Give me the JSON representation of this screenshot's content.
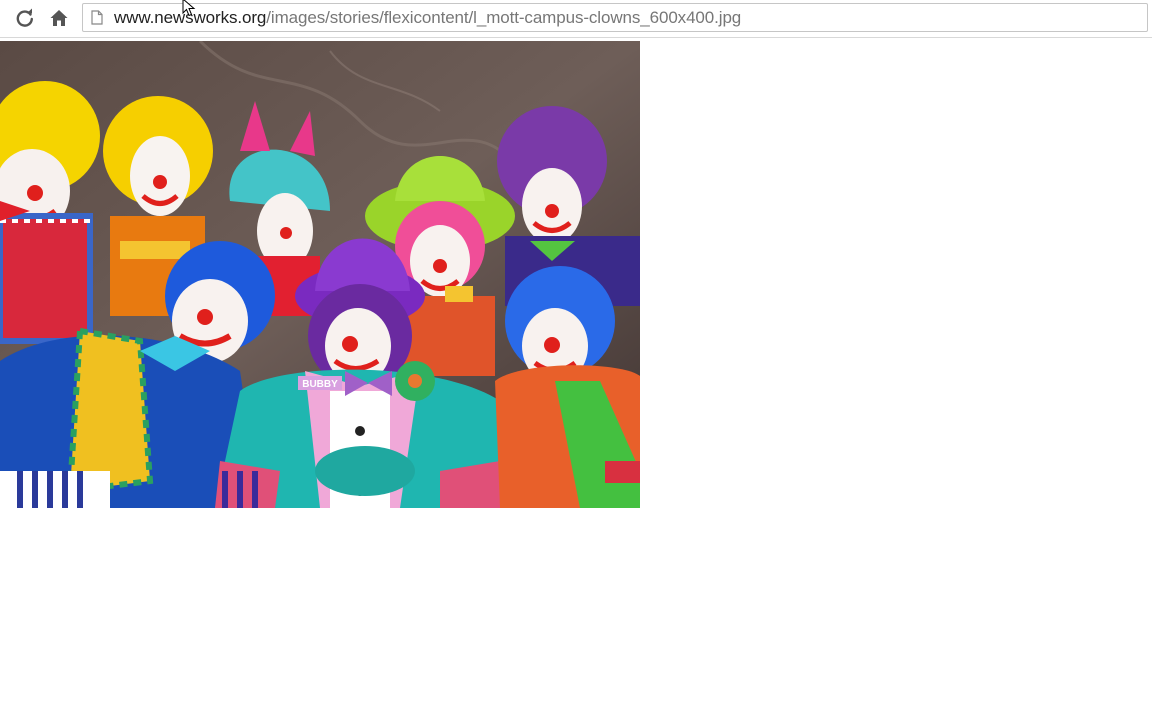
{
  "address_bar": {
    "url_host": "www.newsworks.org",
    "url_path": "/images/stories/flexicontent/l_mott-campus-clowns_600x400.jpg"
  },
  "icons": {
    "reload": "reload-icon",
    "home": "home-icon",
    "page": "page-icon",
    "cursor": "cursor-icon"
  },
  "image": {
    "description_labels": [
      "BUBBY"
    ]
  },
  "colors": {
    "toolbar_border": "#d8d8d8",
    "omnibox_border": "#c6c6c6",
    "url_host": "#222222",
    "url_path": "#777777",
    "page_background": "#ffffff"
  }
}
